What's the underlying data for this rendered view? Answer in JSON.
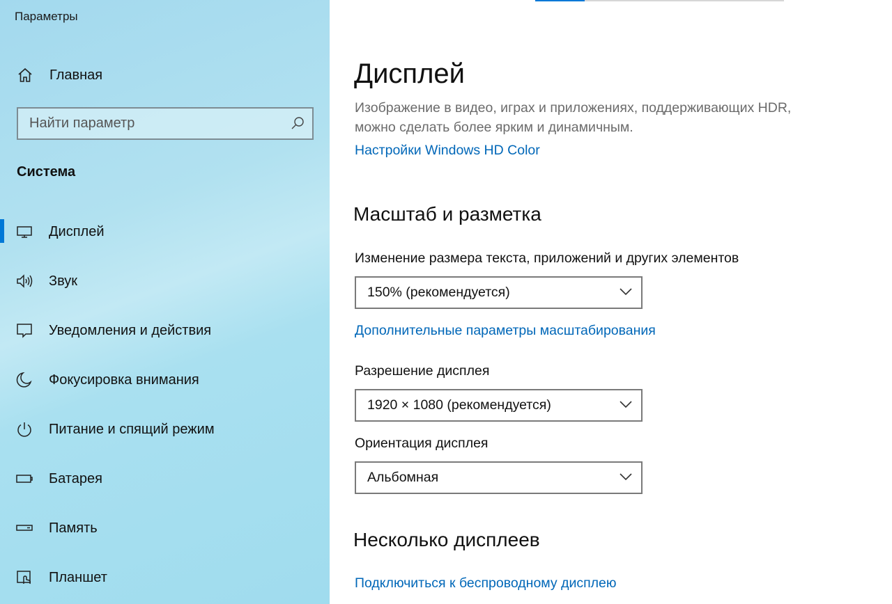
{
  "window": {
    "title": "Параметры"
  },
  "sidebar": {
    "home_label": "Главная",
    "search": {
      "placeholder": "Найти параметр",
      "value": ""
    },
    "section_title": "Система",
    "items": [
      {
        "label": "Дисплей",
        "icon": "monitor-icon",
        "selected": true
      },
      {
        "label": "Звук",
        "icon": "speaker-icon",
        "selected": false
      },
      {
        "label": "Уведомления и действия",
        "icon": "notification-icon",
        "selected": false
      },
      {
        "label": "Фокусировка внимания",
        "icon": "moon-icon",
        "selected": false
      },
      {
        "label": "Питание и спящий режим",
        "icon": "power-icon",
        "selected": false
      },
      {
        "label": "Батарея",
        "icon": "battery-icon",
        "selected": false
      },
      {
        "label": "Память",
        "icon": "storage-icon",
        "selected": false
      },
      {
        "label": "Планшет",
        "icon": "tablet-icon",
        "selected": false
      }
    ]
  },
  "main": {
    "progress": {
      "fraction": 0.2
    },
    "title": "Дисплей",
    "hdr_description": "Изображение в видео, играх и приложениях, поддерживающих HDR, можно сделать более ярким и динамичным.",
    "hdr_link": "Настройки Windows HD Color",
    "scale_section": {
      "title": "Масштаб и разметка",
      "scale_label": "Изменение размера текста, приложений и других элементов",
      "scale_value": "150% (рекомендуется)",
      "advanced_scaling_link": "Дополнительные параметры масштабирования",
      "resolution_label": "Разрешение дисплея",
      "resolution_value": "1920 × 1080 (рекомендуется)",
      "orientation_label": "Ориентация дисплея",
      "orientation_value": "Альбомная"
    },
    "multi_section": {
      "title": "Несколько дисплеев",
      "wireless_link": "Подключиться к беспроводному дисплею"
    }
  },
  "colors": {
    "accent": "#0078d7",
    "link": "#0067b8"
  }
}
